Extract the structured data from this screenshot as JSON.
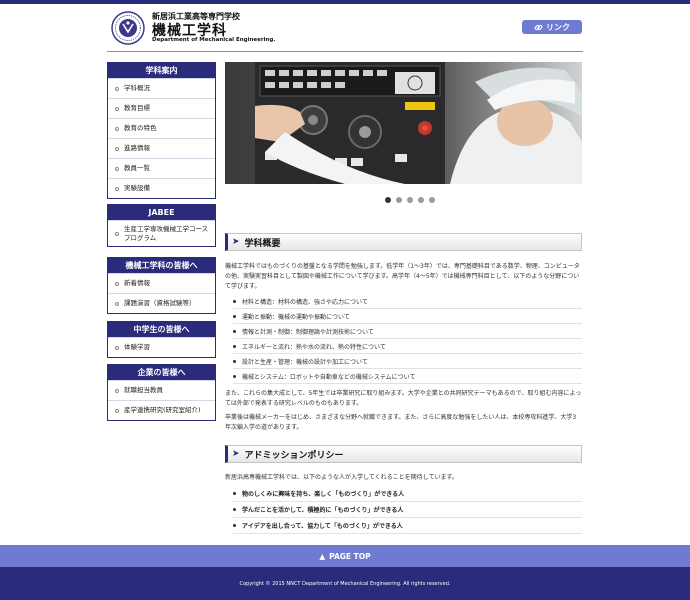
{
  "header": {
    "school_name": "新居浜工業高等専門学校",
    "dept_name": "機械工学科",
    "dept_name_en": "Department of Mechanical Engineering.",
    "link_label": "リンク"
  },
  "sidebar": {
    "groups": [
      {
        "title": "学科案内",
        "items": [
          "学科概況",
          "教育目標",
          "教育の特色",
          "進路情報",
          "教員一覧",
          "実験設備"
        ]
      },
      {
        "title": "JABEE",
        "items": [
          "生産工学専攻機械工学コース　プログラム"
        ]
      },
      {
        "title": "機械工学科の皆様へ",
        "items": [
          "新着情報",
          "課題演習（資格試験等）"
        ]
      },
      {
        "title": "中学生の皆様へ",
        "items": [
          "体験学習"
        ]
      },
      {
        "title": "企業の皆様へ",
        "items": [
          "就職担当教員",
          "産学連携研究(研究室紹介)"
        ]
      }
    ]
  },
  "slider": {
    "count": 5,
    "active_index": 0
  },
  "overview": {
    "heading": "学科概要",
    "intro": "機械工学科ではものづくりの基盤となる学問を勉強します。低学年（1〜3年）では、専門基礎科目である数学、物理、コンピュータの他、実験実習科目として製図や機械工作について学びます。高学年（4〜5年）では機械専門科目として、以下のような分野について学びます。",
    "bullets": [
      "材料と構造：材料の構造、強さや応力について",
      "運動と振動：機械の運動や振動について",
      "情報と計測・制御：制御理論や計測技術について",
      "エネルギーと流れ：熱や水の流れ、熱の特性について",
      "設計と生産・管理：機械の設計や加工について",
      "機械とシステム：ロボットや自動車などの機械システムについて"
    ],
    "para2": "また、これらの集大成として、5年生では卒業研究に取り組みます。大学や企業との共同研究テーマもあるので、取り組む内容によっては外部で発表する研究レベルのものもあります。",
    "para3": "卒業後は機械メーカーをはじめ、さまざまな分野へ就職できます。また、さらに高度な勉強をしたい人は、本校専攻科進学、大学3年次編入学の道があります。"
  },
  "admission": {
    "heading": "アドミッションポリシー",
    "intro": "新居浜高専機械工学科では、以下のような人が入学してくれることを期待しています。",
    "bullets": [
      "物のしくみに興味を持ち、楽しく「ものづくり」ができる人",
      "学んだことを活かして、積極的に「ものづくり」ができる人",
      "アイデアを出し合って、協力して「ものづくり」ができる人"
    ]
  },
  "footer": {
    "page_top_label": "PAGE TOP",
    "copyright": "Copyright © 2015 NNCT Department of Mechanical Engineering. All rights reserved."
  },
  "colors": {
    "navy": "#2b2b7c",
    "accent": "#6f7bd2"
  }
}
